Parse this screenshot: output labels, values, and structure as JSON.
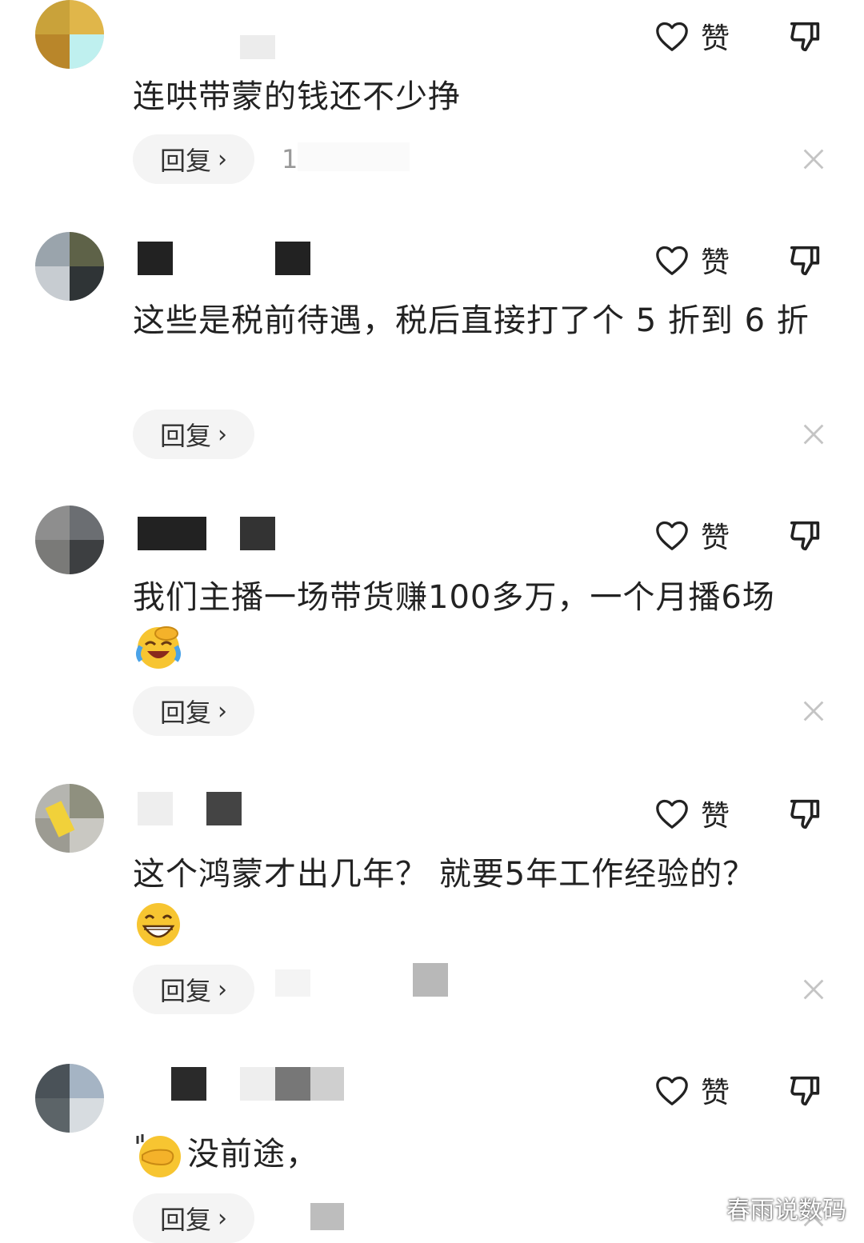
{
  "like_label": "赞",
  "reply_label": "回复",
  "reply_chevron": "›",
  "comments": [
    {
      "text": "连哄带蒙的钱还不少挣",
      "meta": "1"
    },
    {
      "text": "这些是税前待遇，税后直接打了个 5 折到 6 折"
    },
    {
      "text": "我们主播一场带货赚100多万，一个月播6场",
      "emoji": "laughing-crying-emoji"
    },
    {
      "text": "这个鸿蒙才出几年？ 就要5年工作经验的？",
      "emoji": "grinning-emoji"
    },
    {
      "text": "没前途，",
      "emoji": "facepalm-hand-emoji"
    }
  ],
  "watermark": "春雨说数码"
}
